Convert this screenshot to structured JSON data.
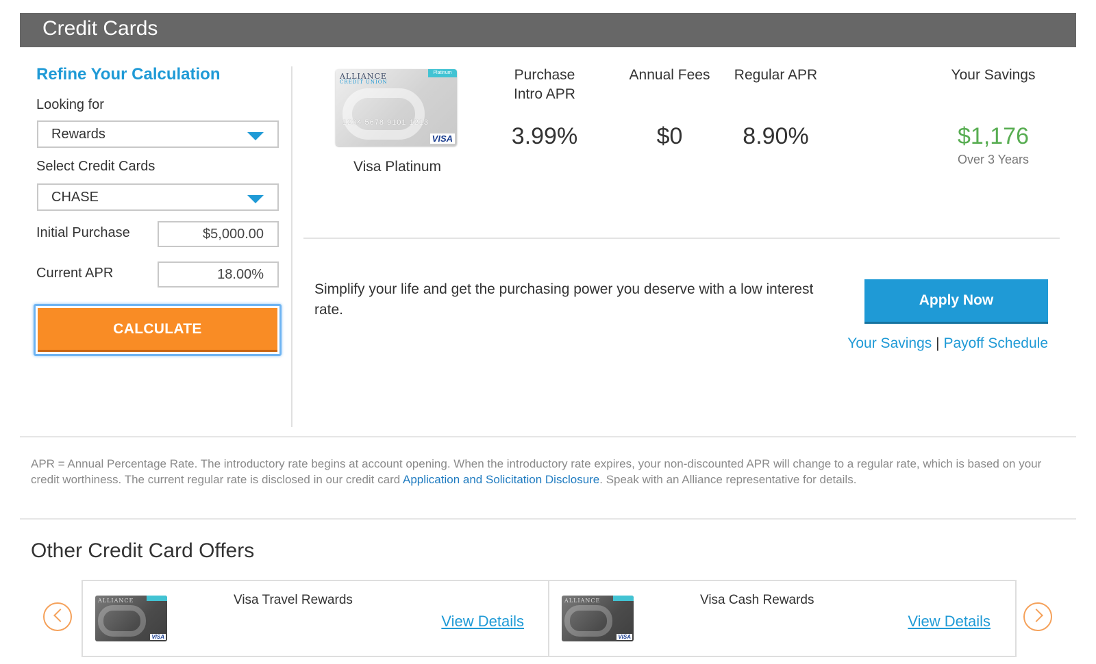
{
  "header": {
    "title": "Credit Cards"
  },
  "refine": {
    "title": "Refine Your Calculation",
    "looking_for_label": "Looking for",
    "looking_for_value": "Rewards",
    "select_cards_label": "Select Credit Cards",
    "select_cards_value": "CHASE",
    "initial_purchase_label": "Initial Purchase",
    "initial_purchase_value": "$5,000.00",
    "current_apr_label": "Current APR",
    "current_apr_value": "18.00%",
    "calculate_label": "CALCULATE"
  },
  "card": {
    "image_brand": "ALLIANCE",
    "image_brand_sub": "CREDIT UNION",
    "image_tag": "Platinum",
    "image_number": "1234 5678 9101 1213",
    "image_network": "VISA",
    "name": "Visa Platinum",
    "columns": [
      {
        "heading": "Purchase Intro APR",
        "value": "3.99%"
      },
      {
        "heading": "Annual Fees",
        "value": "$0"
      },
      {
        "heading": "Regular APR",
        "value": "8.90%"
      }
    ],
    "savings_heading": "Your Savings",
    "savings_value": "$1,176",
    "savings_sub": "Over 3 Years",
    "description": "Simplify your life and get the purchasing power you deserve with a low interest rate.",
    "apply_label": "Apply Now",
    "link_savings": "Your Savings",
    "link_separator": "|",
    "link_payoff": "Payoff Schedule"
  },
  "disclaimer": {
    "text_before": "APR = Annual Percentage Rate. The introductory rate begins at account opening. When the introductory rate expires, your non-discounted APR will change to a regular rate, which is based on your credit worthiness. The current regular rate is disclosed in our credit card ",
    "link": "Application and Solicitation Disclosure",
    "text_after": ". Speak with an Alliance representative for details."
  },
  "offers": {
    "title": "Other Credit Card Offers",
    "items": [
      {
        "name": "Visa Travel Rewards",
        "details_label": "View Details"
      },
      {
        "name": "Visa Cash Rewards",
        "details_label": "View Details"
      }
    ]
  },
  "colors": {
    "accent": "#1f9ad6",
    "button_orange": "#f98c25",
    "savings_green": "#58ad52",
    "header_gray": "#676767"
  }
}
